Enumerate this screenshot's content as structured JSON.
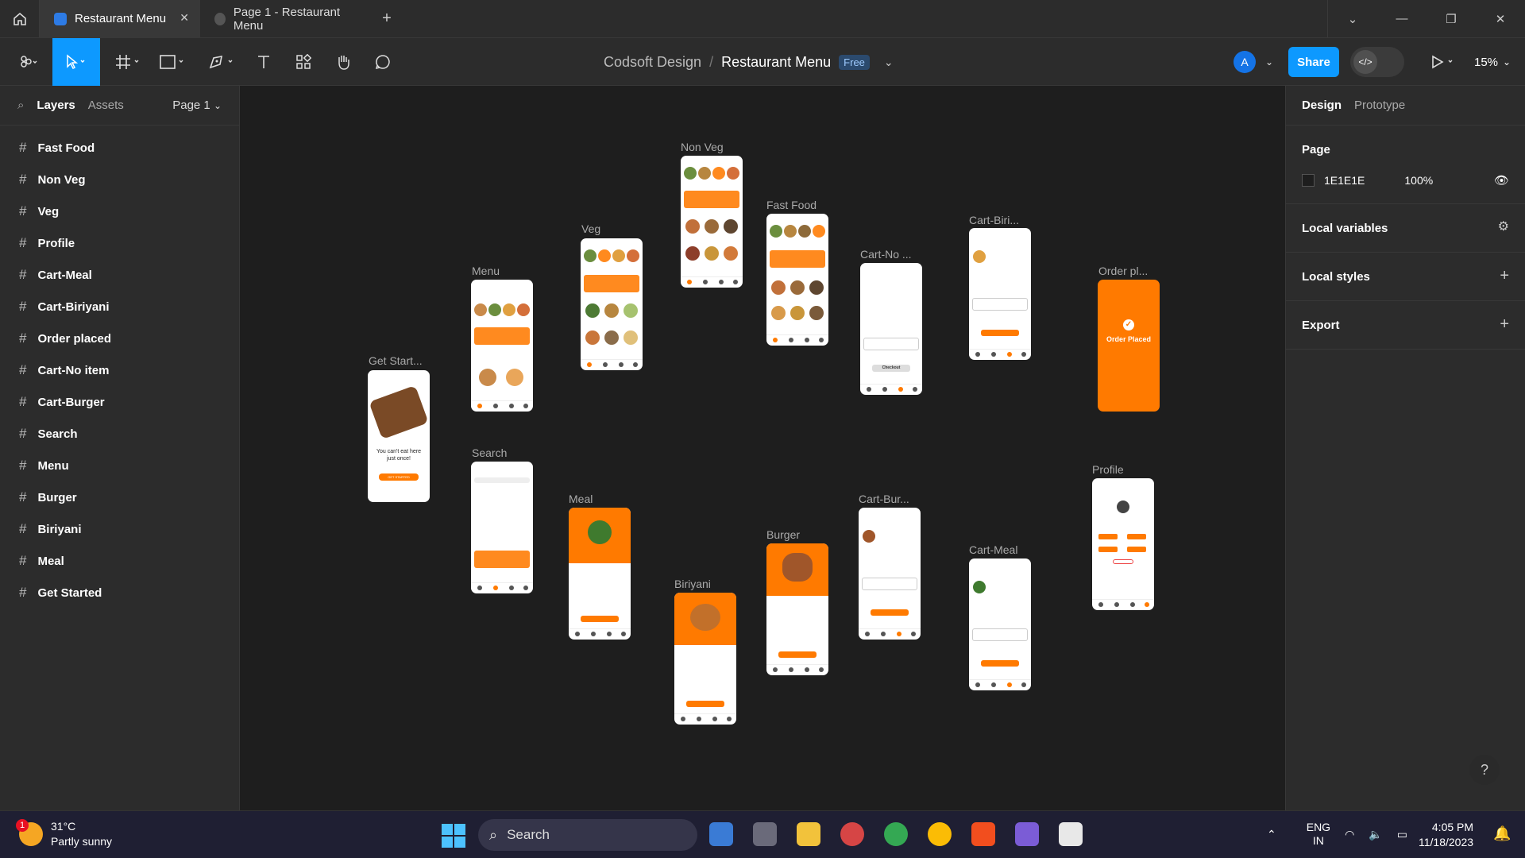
{
  "tabs": {
    "active_label": "Restaurant Menu",
    "second_label": "Page 1 - Restaurant Menu",
    "new_tab": "+"
  },
  "toolbar": {
    "project": "Codsoft Design",
    "separator": "/",
    "file": "Restaurant Menu",
    "plan_badge": "Free",
    "avatar_letter": "A",
    "share_label": "Share",
    "zoom": "15%"
  },
  "layers_panel": {
    "tab_layers": "Layers",
    "tab_assets": "Assets",
    "page_selector": "Page 1",
    "items": [
      "Fast Food",
      "Non Veg",
      "Veg",
      "Profile",
      "Cart-Meal",
      "Cart-Biriyani",
      "Order placed",
      "Cart-No item",
      "Cart-Burger",
      "Search",
      "Menu",
      "Burger",
      "Biriyani",
      "Meal",
      "Get Started"
    ]
  },
  "design_panel": {
    "tab_design": "Design",
    "tab_prototype": "Prototype",
    "page_heading": "Page",
    "page_color": "1E1E1E",
    "page_opacity": "100%",
    "local_variables": "Local variables",
    "local_styles": "Local styles",
    "export": "Export"
  },
  "canvas": {
    "frame_labels": {
      "get_started": "Get Start...",
      "menu": "Menu",
      "veg": "Veg",
      "non_veg": "Non Veg",
      "fast_food": "Fast Food",
      "cart_no": "Cart-No ...",
      "cart_biri": "Cart-Biri...",
      "order_pl": "Order pl...",
      "search": "Search",
      "meal": "Meal",
      "biriyani": "Biriyani",
      "burger": "Burger",
      "cart_bur": "Cart-Bur...",
      "cart_meal": "Cart-Meal",
      "profile": "Profile"
    },
    "order_placed_text": "Order Placed",
    "get_started_text": "You can't eat here just once!",
    "get_started_btn": "GET STARTED",
    "checkout": "Checkout"
  },
  "help": "?",
  "taskbar": {
    "temperature": "31°C",
    "weather": "Partly sunny",
    "notification_count": "1",
    "search_label": "Search",
    "language": "ENG",
    "region": "IN",
    "time": "4:05 PM",
    "date": "11/18/2023"
  },
  "colors": {
    "accent": "#0d99ff",
    "canvas_bg": "#1e1e1e",
    "panel_bg": "#2c2c2c",
    "brand_orange": "#ff7a00"
  }
}
